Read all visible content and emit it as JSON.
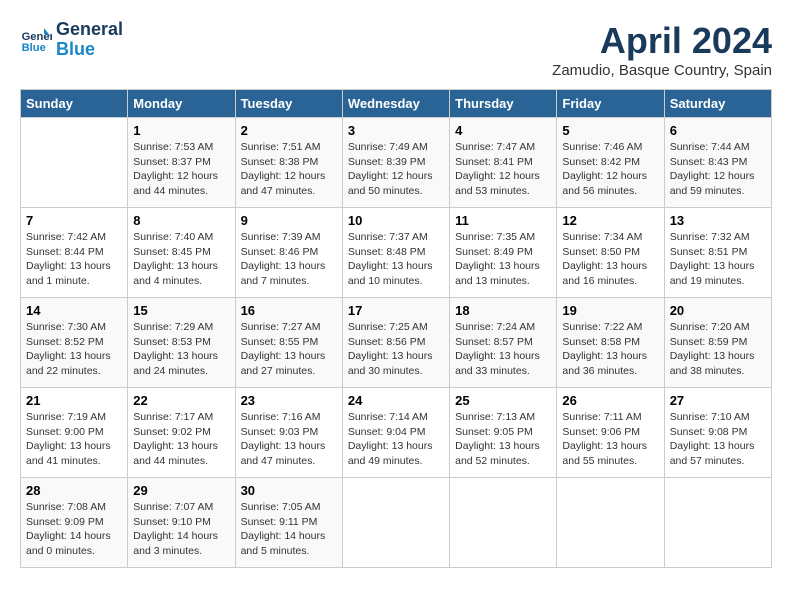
{
  "logo": {
    "line1": "General",
    "line2": "Blue"
  },
  "title": "April 2024",
  "subtitle": "Zamudio, Basque Country, Spain",
  "days_of_week": [
    "Sunday",
    "Monday",
    "Tuesday",
    "Wednesday",
    "Thursday",
    "Friday",
    "Saturday"
  ],
  "weeks": [
    [
      {
        "day": "",
        "info": ""
      },
      {
        "day": "1",
        "info": "Sunrise: 7:53 AM\nSunset: 8:37 PM\nDaylight: 12 hours\nand 44 minutes."
      },
      {
        "day": "2",
        "info": "Sunrise: 7:51 AM\nSunset: 8:38 PM\nDaylight: 12 hours\nand 47 minutes."
      },
      {
        "day": "3",
        "info": "Sunrise: 7:49 AM\nSunset: 8:39 PM\nDaylight: 12 hours\nand 50 minutes."
      },
      {
        "day": "4",
        "info": "Sunrise: 7:47 AM\nSunset: 8:41 PM\nDaylight: 12 hours\nand 53 minutes."
      },
      {
        "day": "5",
        "info": "Sunrise: 7:46 AM\nSunset: 8:42 PM\nDaylight: 12 hours\nand 56 minutes."
      },
      {
        "day": "6",
        "info": "Sunrise: 7:44 AM\nSunset: 8:43 PM\nDaylight: 12 hours\nand 59 minutes."
      }
    ],
    [
      {
        "day": "7",
        "info": "Sunrise: 7:42 AM\nSunset: 8:44 PM\nDaylight: 13 hours\nand 1 minute."
      },
      {
        "day": "8",
        "info": "Sunrise: 7:40 AM\nSunset: 8:45 PM\nDaylight: 13 hours\nand 4 minutes."
      },
      {
        "day": "9",
        "info": "Sunrise: 7:39 AM\nSunset: 8:46 PM\nDaylight: 13 hours\nand 7 minutes."
      },
      {
        "day": "10",
        "info": "Sunrise: 7:37 AM\nSunset: 8:48 PM\nDaylight: 13 hours\nand 10 minutes."
      },
      {
        "day": "11",
        "info": "Sunrise: 7:35 AM\nSunset: 8:49 PM\nDaylight: 13 hours\nand 13 minutes."
      },
      {
        "day": "12",
        "info": "Sunrise: 7:34 AM\nSunset: 8:50 PM\nDaylight: 13 hours\nand 16 minutes."
      },
      {
        "day": "13",
        "info": "Sunrise: 7:32 AM\nSunset: 8:51 PM\nDaylight: 13 hours\nand 19 minutes."
      }
    ],
    [
      {
        "day": "14",
        "info": "Sunrise: 7:30 AM\nSunset: 8:52 PM\nDaylight: 13 hours\nand 22 minutes."
      },
      {
        "day": "15",
        "info": "Sunrise: 7:29 AM\nSunset: 8:53 PM\nDaylight: 13 hours\nand 24 minutes."
      },
      {
        "day": "16",
        "info": "Sunrise: 7:27 AM\nSunset: 8:55 PM\nDaylight: 13 hours\nand 27 minutes."
      },
      {
        "day": "17",
        "info": "Sunrise: 7:25 AM\nSunset: 8:56 PM\nDaylight: 13 hours\nand 30 minutes."
      },
      {
        "day": "18",
        "info": "Sunrise: 7:24 AM\nSunset: 8:57 PM\nDaylight: 13 hours\nand 33 minutes."
      },
      {
        "day": "19",
        "info": "Sunrise: 7:22 AM\nSunset: 8:58 PM\nDaylight: 13 hours\nand 36 minutes."
      },
      {
        "day": "20",
        "info": "Sunrise: 7:20 AM\nSunset: 8:59 PM\nDaylight: 13 hours\nand 38 minutes."
      }
    ],
    [
      {
        "day": "21",
        "info": "Sunrise: 7:19 AM\nSunset: 9:00 PM\nDaylight: 13 hours\nand 41 minutes."
      },
      {
        "day": "22",
        "info": "Sunrise: 7:17 AM\nSunset: 9:02 PM\nDaylight: 13 hours\nand 44 minutes."
      },
      {
        "day": "23",
        "info": "Sunrise: 7:16 AM\nSunset: 9:03 PM\nDaylight: 13 hours\nand 47 minutes."
      },
      {
        "day": "24",
        "info": "Sunrise: 7:14 AM\nSunset: 9:04 PM\nDaylight: 13 hours\nand 49 minutes."
      },
      {
        "day": "25",
        "info": "Sunrise: 7:13 AM\nSunset: 9:05 PM\nDaylight: 13 hours\nand 52 minutes."
      },
      {
        "day": "26",
        "info": "Sunrise: 7:11 AM\nSunset: 9:06 PM\nDaylight: 13 hours\nand 55 minutes."
      },
      {
        "day": "27",
        "info": "Sunrise: 7:10 AM\nSunset: 9:08 PM\nDaylight: 13 hours\nand 57 minutes."
      }
    ],
    [
      {
        "day": "28",
        "info": "Sunrise: 7:08 AM\nSunset: 9:09 PM\nDaylight: 14 hours\nand 0 minutes."
      },
      {
        "day": "29",
        "info": "Sunrise: 7:07 AM\nSunset: 9:10 PM\nDaylight: 14 hours\nand 3 minutes."
      },
      {
        "day": "30",
        "info": "Sunrise: 7:05 AM\nSunset: 9:11 PM\nDaylight: 14 hours\nand 5 minutes."
      },
      {
        "day": "",
        "info": ""
      },
      {
        "day": "",
        "info": ""
      },
      {
        "day": "",
        "info": ""
      },
      {
        "day": "",
        "info": ""
      }
    ]
  ]
}
